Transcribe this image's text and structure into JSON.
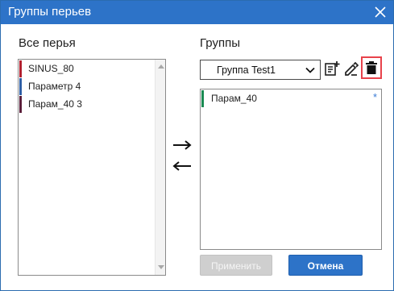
{
  "window": {
    "title": "Группы перьев"
  },
  "left": {
    "label": "Все перья",
    "items": [
      {
        "label": "SINUS_80",
        "color": "#b2202f"
      },
      {
        "label": "Параметр 4",
        "color": "#2f5fa6"
      },
      {
        "label": "Парам_40 3",
        "color": "#5b1f3b"
      }
    ]
  },
  "right": {
    "label": "Группы",
    "select_value": "Группа Test1",
    "items": [
      {
        "label": "Парам_40",
        "color": "#1a8a52",
        "marker": "*"
      }
    ]
  },
  "icons": {
    "close": "close-icon",
    "add": "add-note-icon",
    "edit": "edit-pencil-icon",
    "delete": "trash-icon",
    "move_right": "arrow-right-icon",
    "move_left": "arrow-left-icon"
  },
  "buttons": {
    "apply": "Применить",
    "cancel": "Отмена"
  },
  "colors": {
    "accent": "#2d73c8",
    "highlight": "#e8424b"
  }
}
